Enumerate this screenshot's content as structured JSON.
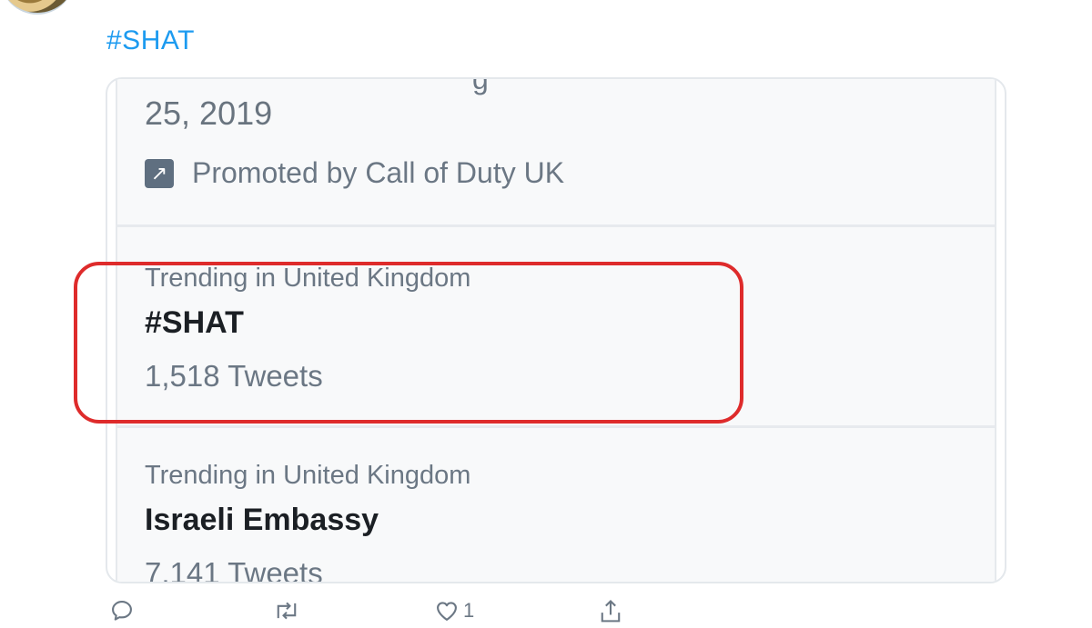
{
  "tweet": {
    "hashtag": "#SHAT"
  },
  "card": {
    "cut_text": "g",
    "date": "25, 2019",
    "promoted_by": "Promoted by Call of Duty UK",
    "trends": [
      {
        "context": "Trending in United Kingdom",
        "name": "#SHAT",
        "count": "1,518 Tweets"
      },
      {
        "context": "Trending in United Kingdom",
        "name": "Israeli Embassy",
        "count": "7,141 Tweets"
      }
    ]
  },
  "actions": {
    "like_count": "1"
  },
  "colors": {
    "link": "#1d9bf0",
    "highlight": "#de2b2b",
    "secondary_text": "#6b7784",
    "primary_text": "#1b1f24"
  },
  "icons": {
    "reply": "reply-icon",
    "retweet": "retweet-icon",
    "like": "heart-icon",
    "share": "share-icon",
    "promoted": "promoted-arrow-icon"
  }
}
